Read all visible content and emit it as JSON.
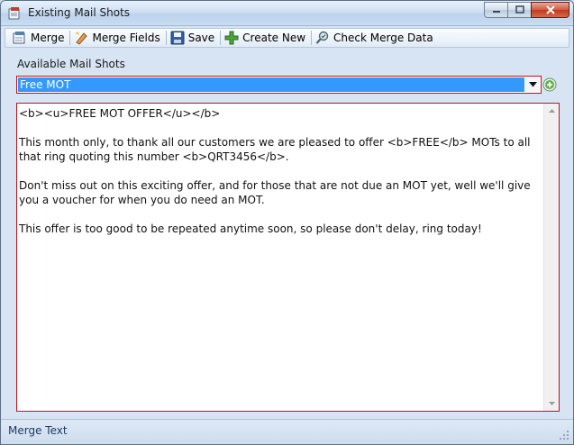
{
  "window": {
    "title": "Existing Mail Shots"
  },
  "toolbar": {
    "merge_label": "Merge",
    "merge_fields_label": "Merge Fields",
    "save_label": "Save",
    "create_new_label": "Create New",
    "check_merge_label": "Check Merge Data"
  },
  "mail_shots": {
    "label": "Available Mail Shots",
    "selected": "Free MOT"
  },
  "editor": {
    "paragraphs": [
      "<b><u>FREE MOT OFFER</u></b>",
      "This month only, to thank all our customers we are pleased to offer <b>FREE</b> MOTs to all that ring quoting this number <b>QRT3456</b>.",
      "Don't miss out on this exciting offer, and for those that are not due an MOT yet, well we'll give you a voucher for when you do need an MOT.",
      "This offer is too good to be repeated anytime soon, so please don't delay, ring today!"
    ]
  },
  "status": {
    "text": "Merge Text"
  },
  "icons": {
    "app": "mail-app-icon",
    "merge": "merge-icon",
    "merge_fields": "merge-fields-icon",
    "save": "floppy-disk-icon",
    "create_new": "plus-icon",
    "check_merge": "magnifier-check-icon",
    "add_mail_shot": "add-circle-icon"
  },
  "colors": {
    "selection": "#3399ff",
    "required_border": "#c4131c",
    "close_button": "#c13a1e"
  }
}
